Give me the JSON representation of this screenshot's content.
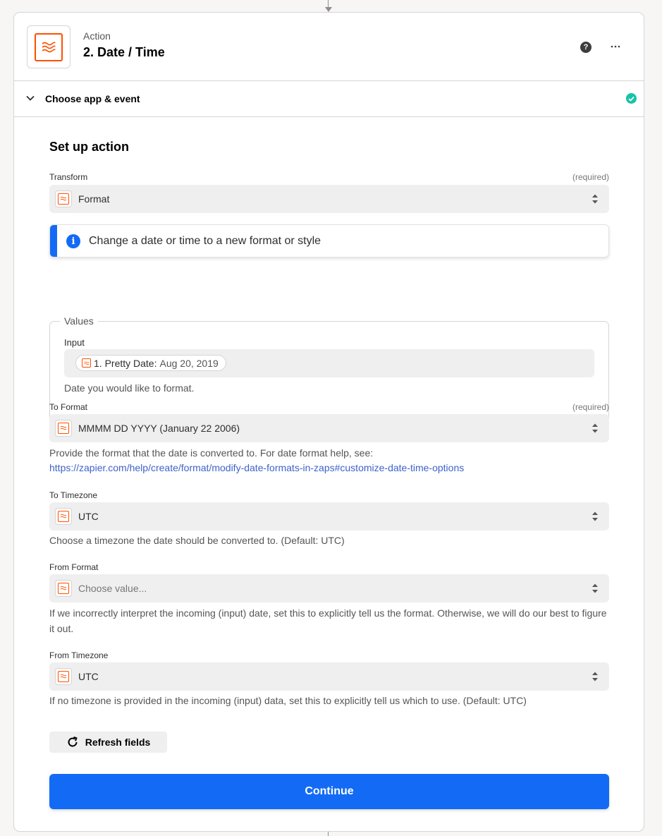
{
  "step": {
    "kicker": "Action",
    "title": "2. Date / Time",
    "app_icon": "formatter-icon",
    "help_icon": "help-icon",
    "more_icon": "more-icon"
  },
  "section": {
    "label": "Choose app & event",
    "status_icon": "check-circle-icon"
  },
  "setup": {
    "title": "Set up action",
    "transform": {
      "label": "Transform",
      "required": "(required)",
      "value": "Format"
    },
    "info": {
      "text": "Change a date or time to a new format or style"
    },
    "values": {
      "legend": "Values",
      "input_label": "Input",
      "pill_label": "1. Pretty Date:",
      "pill_value": "Aug 20, 2019",
      "helper": "Date you would like to format."
    },
    "to_format": {
      "label": "To Format",
      "required": "(required)",
      "value": "MMMM DD YYYY (January 22 2006)",
      "helper": "Provide the format that the date is converted to. For date format help, see:",
      "link": "https://zapier.com/help/create/format/modify-date-formats-in-zaps#customize-date-time-options"
    },
    "to_timezone": {
      "label": "To Timezone",
      "value": "UTC",
      "helper": "Choose a timezone the date should be converted to. (Default: UTC)"
    },
    "from_format": {
      "label": "From Format",
      "placeholder": "Choose value...",
      "helper": "If we incorrectly interpret the incoming (input) date, set this to explicitly tell us the format. Otherwise, we will do our best to figure it out."
    },
    "from_timezone": {
      "label": "From Timezone",
      "value": "UTC",
      "helper": "If no timezone is provided in the incoming (input) data, set this to explicitly tell us which to use. (Default: UTC)"
    },
    "refresh_label": "Refresh fields",
    "continue_label": "Continue"
  },
  "colors": {
    "brand_orange": "#ff4f00",
    "primary_blue": "#136bf5",
    "success_green": "#16c3a6",
    "link_blue": "#3d63c9"
  }
}
